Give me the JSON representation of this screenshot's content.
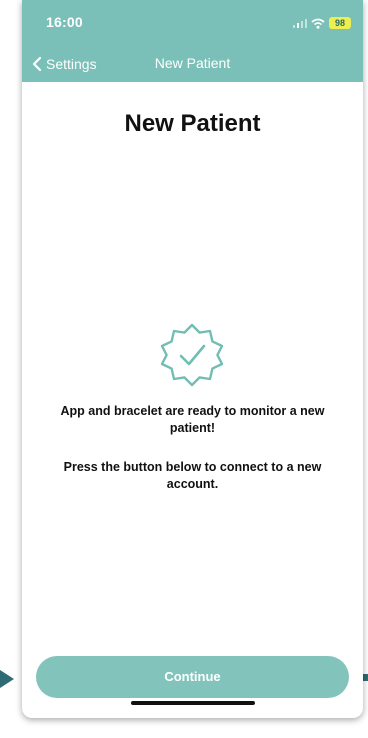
{
  "status_bar": {
    "time": "16:00",
    "battery": "98",
    "icons": [
      "signal-icon",
      "wifi-icon",
      "battery-icon"
    ]
  },
  "nav": {
    "back_label": "Settings",
    "title": "New Patient"
  },
  "main": {
    "heading": "New Patient",
    "icon": "verified-badge-icon",
    "message_ready": "App and bracelet are ready to monitor a new patient!",
    "message_instruction": "Press the button below to connect to a new account."
  },
  "footer": {
    "continue_label": "Continue"
  },
  "colors": {
    "header": "#7ac0b8",
    "button": "#82c4bc",
    "badge_stroke": "#72bdb4",
    "annotation_arrow": "#2e6b75",
    "battery": "#ecef4f"
  }
}
